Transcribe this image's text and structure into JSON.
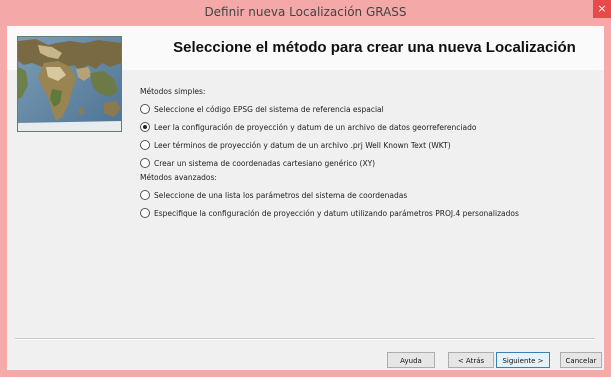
{
  "window": {
    "title": "Definir nueva Localización GRASS",
    "close_glyph": "×"
  },
  "banner": {
    "title": "Seleccione el método para crear una nueva Localización",
    "image_icon": "world-map-icon"
  },
  "simple_methods": {
    "label": "Métodos simples:",
    "options": [
      {
        "label": "Seleccione el código EPSG del sistema de referencia espacial",
        "checked": false
      },
      {
        "label": "Leer la configuración de proyección y datum de un archivo de datos georreferenciado",
        "checked": true
      },
      {
        "label": "Leer términos de proyección y datum de un archivo .prj Well Known Text (WKT)",
        "checked": false
      },
      {
        "label": "Crear un sistema de coordenadas cartesiano genérico (XY)",
        "checked": false
      }
    ]
  },
  "advanced_methods": {
    "label": "Métodos avanzados:",
    "options": [
      {
        "label": "Seleccione de una lista los parámetros del sistema de coordenadas",
        "checked": false
      },
      {
        "label": "Especifique la configuración de proyección y datum utilizando parámetros PROJ.4 personalizados",
        "checked": false
      }
    ]
  },
  "buttons": {
    "help": "Ayuda",
    "back": "< Atrás",
    "next": "Siguiente >",
    "cancel": "Cancelar"
  },
  "colors": {
    "titlebar": "#f4a9a8",
    "close_button": "#e84a4a",
    "dialog_background": "#f0f0f0"
  }
}
